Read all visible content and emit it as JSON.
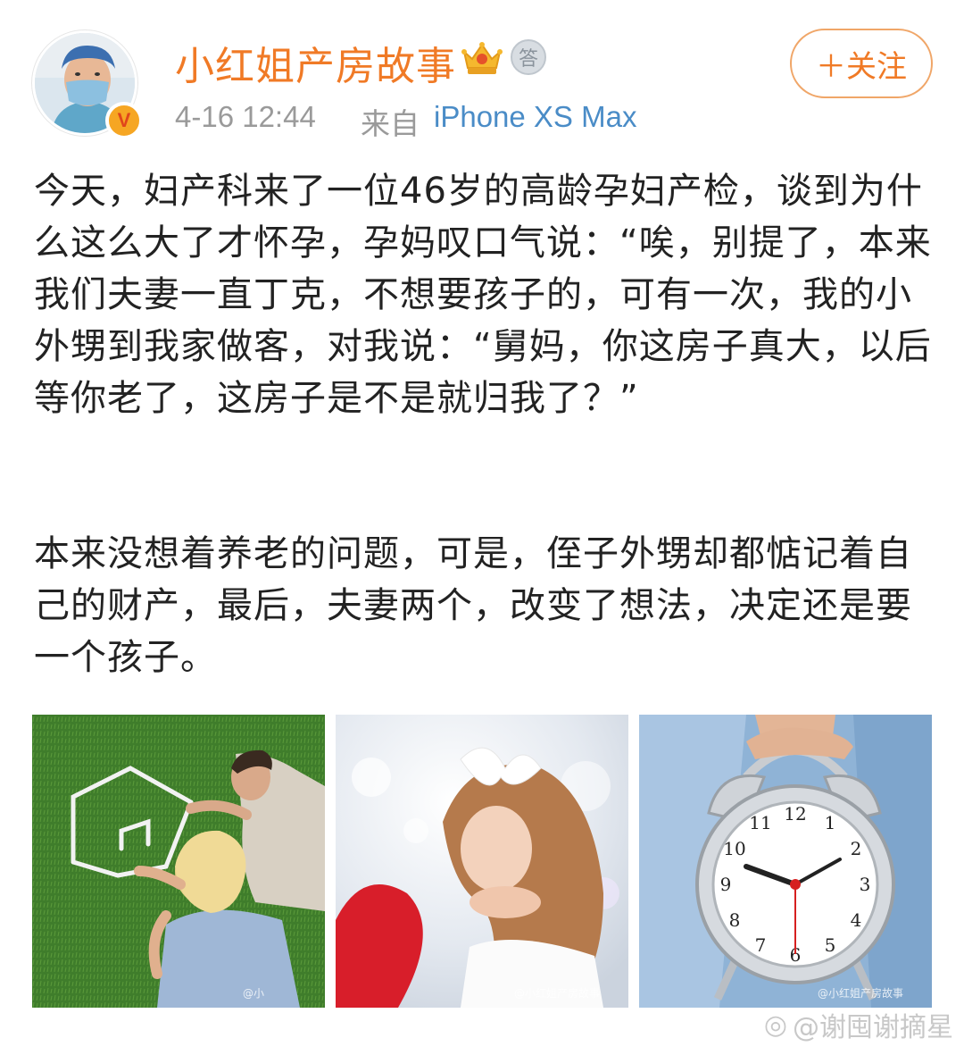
{
  "header": {
    "username": "小红姐产房故事",
    "time": "4-16 12:44",
    "from_label": "来自",
    "device": "iPhone XS Max",
    "follow_label": "＋关注",
    "answer_badge": "答",
    "verify_badge": "V"
  },
  "post": {
    "paragraph_1": "今天，妇产科来了一位46岁的高龄孕妇产检，谈到为什么这么大了才怀孕，孕妈叹口气说：“唉，别提了，本来我们夫妻一直丁克，不想要孩子的，可有一次，我的小外甥到我家做客，对我说：“舅妈，你这房子真大，以后等你老了，这房子是不是就归我了？”",
    "paragraph_2": "本来没想着养老的问题，可是，侄子外甥却都惦记着自己的财产，最后，夫妻两个，改变了想法，决定还是要一个孩子。"
  },
  "images": {
    "watermark_1": "@小",
    "watermark_2": "@小红姐产房故事",
    "watermark_3": "@小红姐产房故事"
  },
  "footer": {
    "watermark": "@谢囤谢摘星"
  },
  "colors": {
    "username": "#f07a26",
    "device": "#4a8cc7",
    "meta": "#9a9a9a",
    "follow_border": "#f0a668"
  }
}
